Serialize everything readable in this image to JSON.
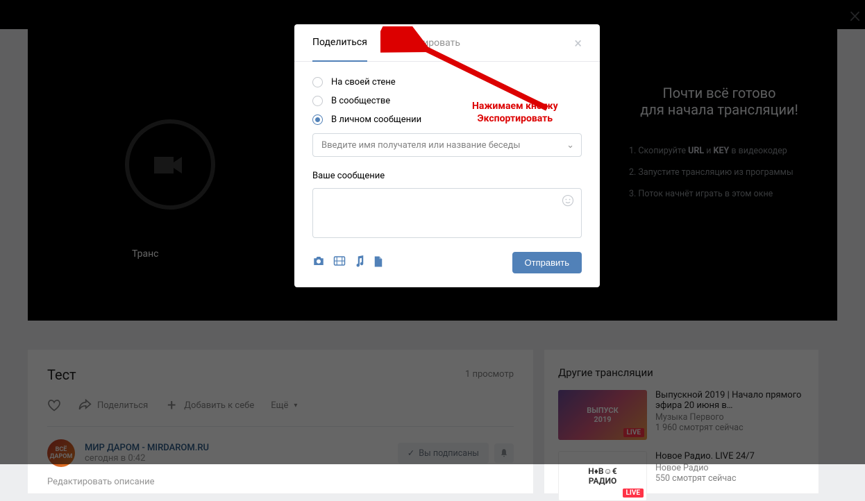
{
  "header": {},
  "player": {
    "left_label": "Транс",
    "heading1": "Почти всё готово",
    "heading2": "для начала трансляции!",
    "step1_pre": "1. Скопируйте ",
    "step1_b1": "URL",
    "step1_mid": " и ",
    "step1_b2": "KEY",
    "step1_post": " в видеокодер",
    "step2": "2. Запустите трансляцию из программы",
    "step3": "3. Поток начнёт играть в этом окне"
  },
  "info": {
    "title": "Тест",
    "views": "1 просмотр",
    "share": "Поделиться",
    "add": "Добавить к себе",
    "more": "Ещё",
    "author": "МИР ДАРОМ - MIRDAROM.RU",
    "time": "сегодня в 0:42",
    "subscribed": "Вы подписаны",
    "edit": "Редактировать описание",
    "avatar_text": "ВСЁ\nДАРОМ"
  },
  "right": {
    "heading": "Другие трансляции",
    "items": [
      {
        "thumb": "ВЫПУСК\n2019",
        "title": "Выпускной 2019 | Начало прямого эфира 20 июня в…",
        "sub1": "Музыка Первого",
        "sub2": "1 960 смотрят сейчас"
      },
      {
        "thumb": "Н♦В☺€\nРАДИО",
        "title": "Новое Радио. LIVE 24/7",
        "sub1": "Новое Радио",
        "sub2": "550 смотрят сейчас"
      }
    ],
    "live": "LIVE"
  },
  "modal": {
    "tab_share": "Поделиться",
    "tab_export": "Экспортировать",
    "opt_wall": "На своей стене",
    "opt_community": "В сообществе",
    "opt_message": "В личном сообщении",
    "recipient_placeholder": "Введите имя получателя или название беседы",
    "msg_label": "Ваше сообщение",
    "send": "Отправить"
  },
  "annotation": {
    "line1": "Нажимаем кнопку",
    "line2": "Экспортировать"
  }
}
